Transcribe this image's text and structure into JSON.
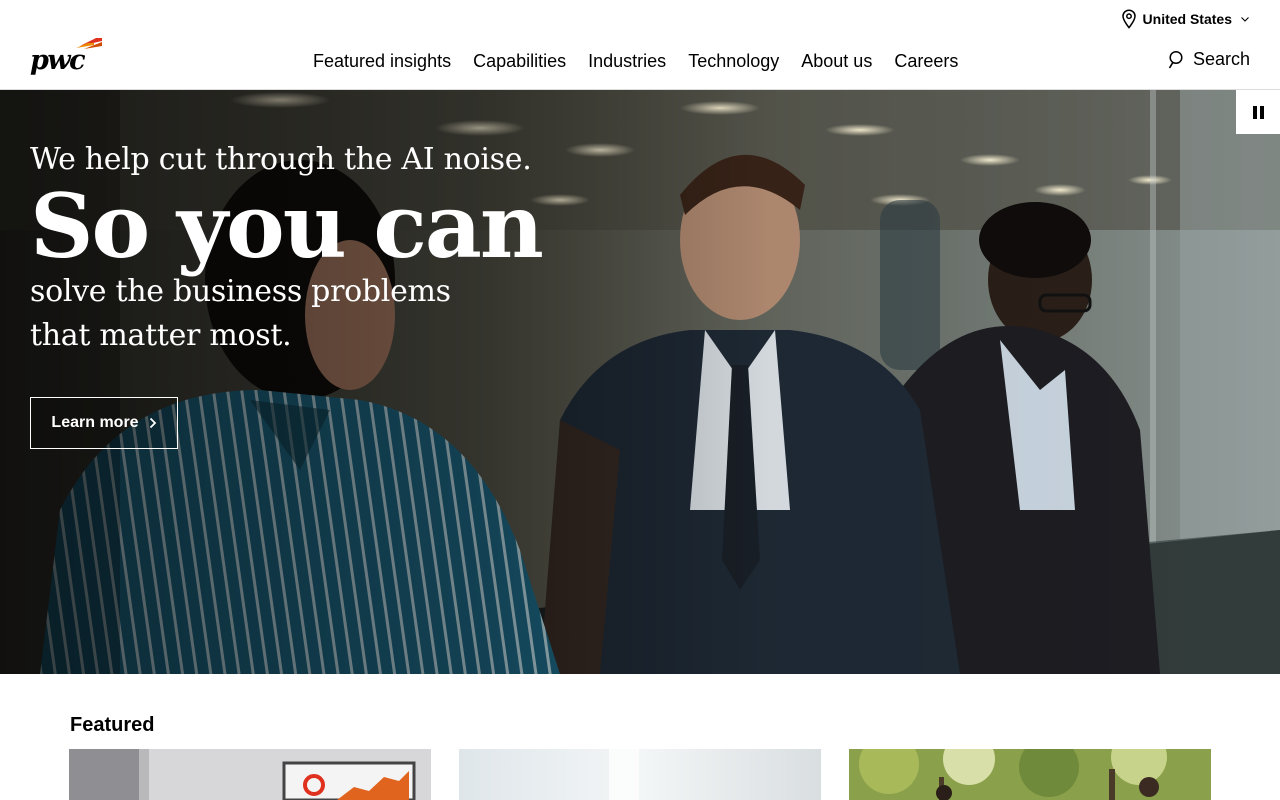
{
  "header": {
    "locale": "United States",
    "nav": [
      "Featured insights",
      "Capabilities",
      "Industries",
      "Technology",
      "About us",
      "Careers"
    ],
    "search_label": "Search"
  },
  "hero": {
    "line1": "We help cut through the AI noise.",
    "big": "So you can",
    "line3": "solve the business problems that matter most.",
    "cta": "Learn more"
  },
  "featured": {
    "title": "Featured"
  },
  "colors": {
    "brand_orange": "#e0301e",
    "brand_red": "#d04a02",
    "text": "#000000"
  }
}
